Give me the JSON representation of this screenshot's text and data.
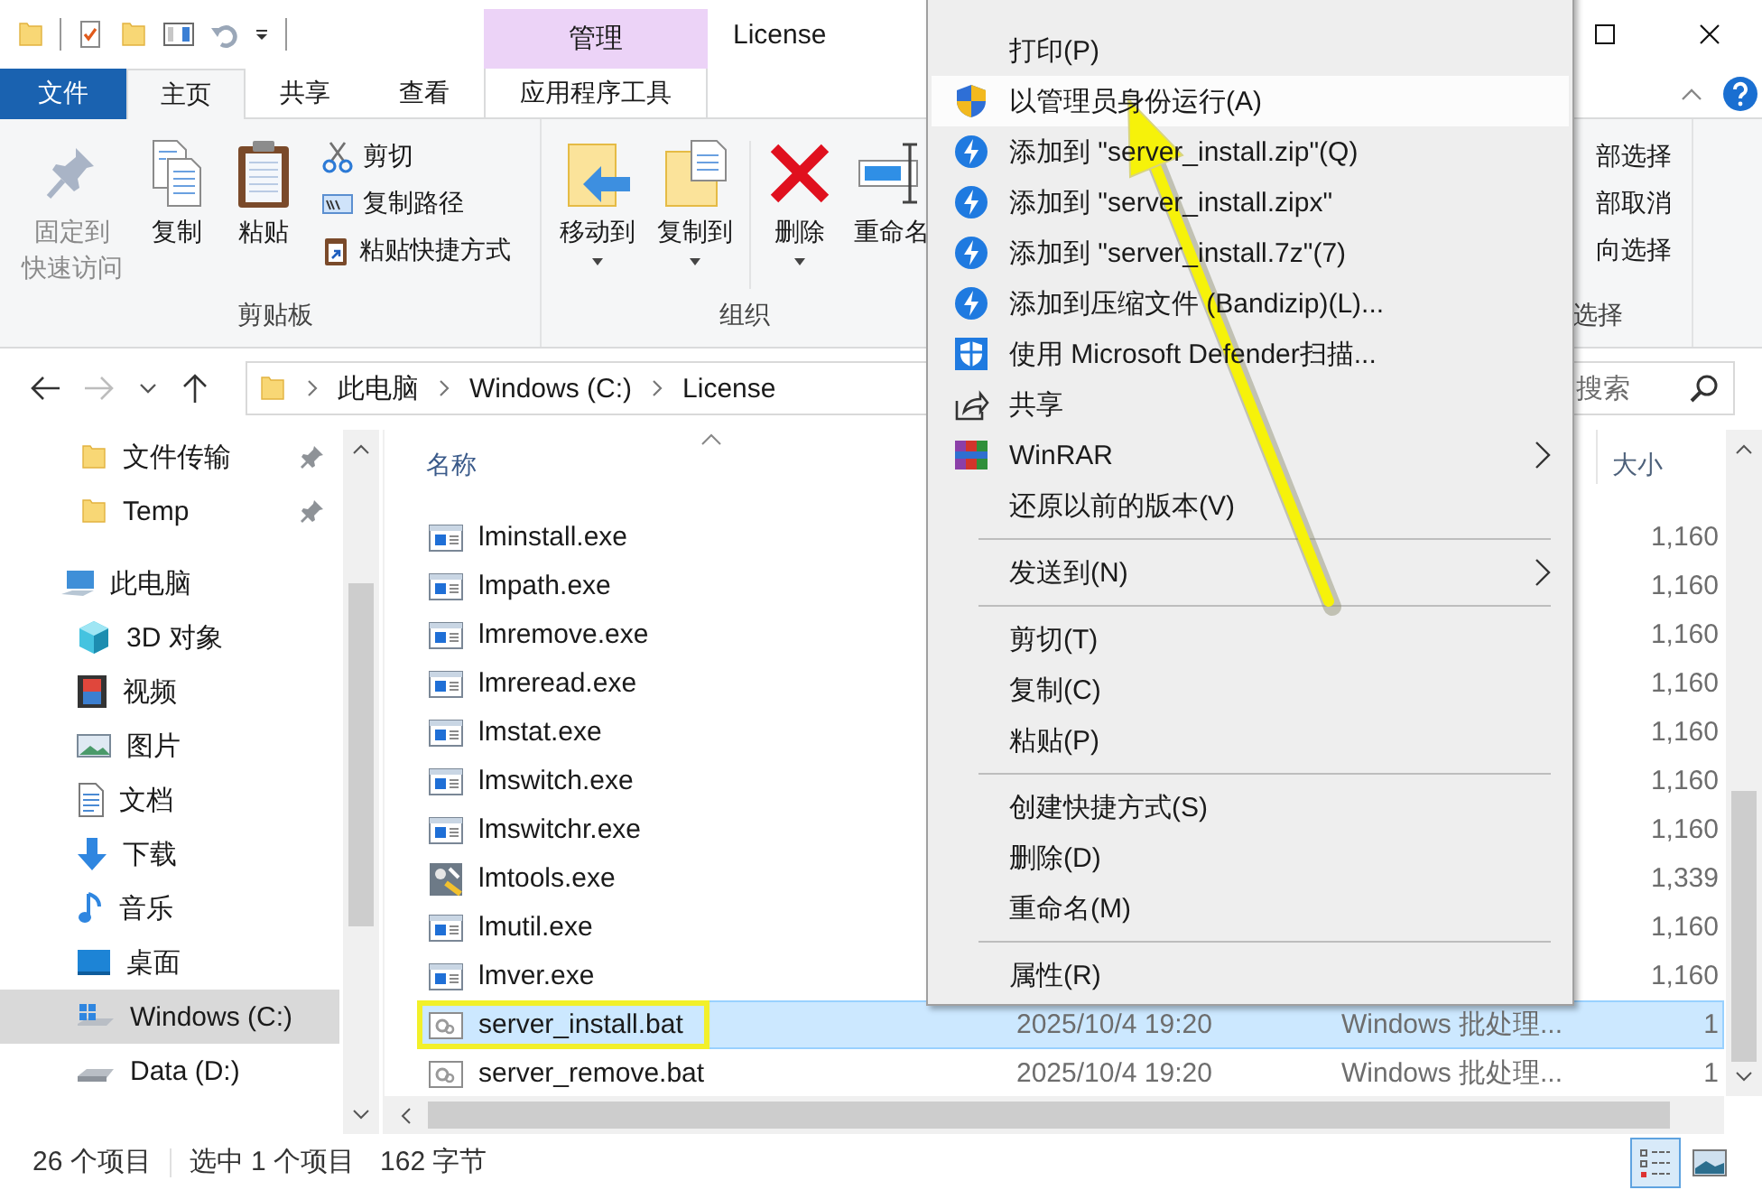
{
  "title_bar": {
    "context_tab": "管理",
    "title": "License"
  },
  "ribbon_tabs": [
    {
      "label": "文件",
      "kind": "file",
      "selected": false
    },
    {
      "label": "主页",
      "kind": "tab",
      "selected": true
    },
    {
      "label": "共享",
      "kind": "tab",
      "selected": false
    },
    {
      "label": "查看",
      "kind": "tab",
      "selected": false
    },
    {
      "label": "应用程序工具",
      "kind": "context",
      "selected": false
    }
  ],
  "ribbon_groups": [
    {
      "label": "剪贴板",
      "buttons": [
        {
          "kind": "large",
          "label": [
            "固定到",
            "快速访问"
          ],
          "disabled": true
        },
        {
          "kind": "large",
          "label": "复制",
          "disabled": false
        },
        {
          "kind": "large",
          "label": "粘贴",
          "disabled": false
        },
        {
          "kind": "small",
          "label": "剪切",
          "disabled": false
        },
        {
          "kind": "small",
          "label": "复制路径",
          "disabled": false
        },
        {
          "kind": "small",
          "label": "粘贴快捷方式",
          "disabled": false
        }
      ]
    },
    {
      "label": "组织",
      "buttons": [
        {
          "kind": "large",
          "label": "移动到",
          "disabled": false,
          "dropdown": true
        },
        {
          "kind": "large",
          "label": "复制到",
          "disabled": false,
          "dropdown": true
        },
        {
          "kind": "separator"
        },
        {
          "kind": "large",
          "label": "删除",
          "disabled": false,
          "dropdown": true
        },
        {
          "kind": "large",
          "label": "重命名",
          "disabled": false,
          "dropdown": false
        }
      ]
    },
    {
      "label": "选择",
      "buttons": [
        {
          "kind": "text",
          "label": "部选择"
        },
        {
          "kind": "text",
          "label": "部取消"
        },
        {
          "kind": "text",
          "label": "向选择"
        }
      ]
    }
  ],
  "address_bar": {
    "breadcrumbs": [
      "此电脑",
      "Windows (C:)",
      "License"
    ]
  },
  "search": {
    "placeholder": "搜索"
  },
  "navigation": [
    {
      "label": "文件传输",
      "pinned": true,
      "selected": false
    },
    {
      "label": "Temp",
      "pinned": true,
      "selected": false
    },
    {
      "label": "此电脑",
      "selected": false,
      "children": [
        {
          "label": "3D 对象",
          "selected": false
        },
        {
          "label": "视频",
          "selected": false
        },
        {
          "label": "图片",
          "selected": false
        },
        {
          "label": "文档",
          "selected": false
        },
        {
          "label": "下载",
          "selected": false
        },
        {
          "label": "音乐",
          "selected": false
        },
        {
          "label": "桌面",
          "selected": false
        },
        {
          "label": "Windows (C:)",
          "selected": true
        },
        {
          "label": "Data (D:)",
          "selected": false
        }
      ]
    }
  ],
  "columns": [
    {
      "label": "名称",
      "sorted": true
    },
    {
      "label": "大小",
      "sorted": false
    }
  ],
  "files": [
    {
      "name": "lminstall.exe",
      "kind": "exe",
      "size": "1,160",
      "selected": false
    },
    {
      "name": "lmpath.exe",
      "kind": "exe",
      "size": "1,160",
      "selected": false
    },
    {
      "name": "lmremove.exe",
      "kind": "exe",
      "size": "1,160",
      "selected": false
    },
    {
      "name": "lmreread.exe",
      "kind": "exe",
      "size": "1,160",
      "selected": false
    },
    {
      "name": "lmstat.exe",
      "kind": "exe",
      "size": "1,160",
      "selected": false
    },
    {
      "name": "lmswitch.exe",
      "kind": "exe",
      "size": "1,160",
      "selected": false
    },
    {
      "name": "lmswitchr.exe",
      "kind": "exe",
      "size": "1,160",
      "selected": false
    },
    {
      "name": "lmtools.exe",
      "kind": "tool",
      "size": "1,339",
      "selected": false
    },
    {
      "name": "lmutil.exe",
      "kind": "exe",
      "size": "1,160",
      "selected": false
    },
    {
      "name": "lmver.exe",
      "kind": "exe",
      "size": "1,160",
      "selected": false
    },
    {
      "name": "server_install.bat",
      "kind": "bat",
      "date": "2025/10/4 19:20",
      "type": "Windows 批处理...",
      "size": "1",
      "selected": true,
      "annotated": true
    },
    {
      "name": "server_remove.bat",
      "kind": "bat",
      "date": "2025/10/4 19:20",
      "type": "Windows 批处理...",
      "size": "1",
      "selected": false,
      "annotated": false
    }
  ],
  "context_menu": [
    {
      "kind": "item",
      "label": "打印(P)",
      "highlighted": false
    },
    {
      "kind": "item",
      "label": "以管理员身份运行(A)",
      "highlighted": true
    },
    {
      "kind": "item",
      "label": "添加到 \"server_install.zip\"(Q)",
      "highlighted": false
    },
    {
      "kind": "item",
      "label": "添加到 \"server_install.zipx\"",
      "highlighted": false
    },
    {
      "kind": "item",
      "label": "添加到 \"server_install.7z\"(7)",
      "highlighted": false
    },
    {
      "kind": "item",
      "label": "添加到压缩文件 (Bandizip)(L)...",
      "highlighted": false
    },
    {
      "kind": "item",
      "label": "使用 Microsoft Defender扫描...",
      "highlighted": false
    },
    {
      "kind": "item",
      "label": "共享",
      "highlighted": false
    },
    {
      "kind": "item",
      "label": "WinRAR",
      "highlighted": false,
      "submenu": true
    },
    {
      "kind": "item",
      "label": "还原以前的版本(V)",
      "highlighted": false
    },
    {
      "kind": "separator"
    },
    {
      "kind": "item",
      "label": "发送到(N)",
      "highlighted": false,
      "submenu": true
    },
    {
      "kind": "separator"
    },
    {
      "kind": "item",
      "label": "剪切(T)",
      "highlighted": false
    },
    {
      "kind": "item",
      "label": "复制(C)",
      "highlighted": false
    },
    {
      "kind": "item",
      "label": "粘贴(P)",
      "highlighted": false
    },
    {
      "kind": "separator"
    },
    {
      "kind": "item",
      "label": "创建快捷方式(S)",
      "highlighted": false
    },
    {
      "kind": "item",
      "label": "删除(D)",
      "highlighted": false
    },
    {
      "kind": "item",
      "label": "重命名(M)",
      "highlighted": false
    },
    {
      "kind": "separator"
    },
    {
      "kind": "item",
      "label": "属性(R)",
      "highlighted": false
    }
  ],
  "status_bar": {
    "item_count": "26 个项目",
    "selection": "选中 1 个项目",
    "size": "162 字节"
  },
  "view_buttons": [
    {
      "selected": true
    },
    {
      "selected": false
    }
  ]
}
